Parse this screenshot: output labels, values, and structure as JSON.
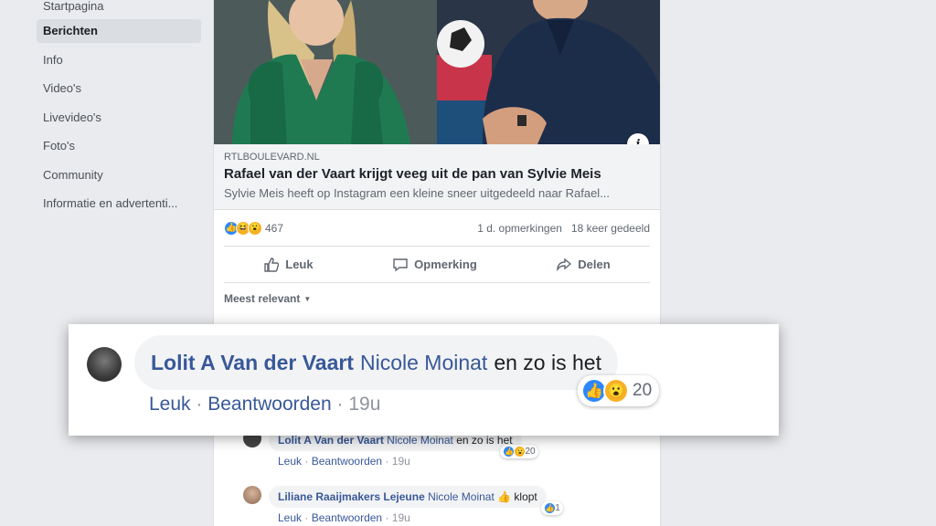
{
  "sidebar": {
    "items": [
      {
        "label": "Startpagina"
      },
      {
        "label": "Berichten"
      },
      {
        "label": "Info"
      },
      {
        "label": "Video's"
      },
      {
        "label": "Livevideo's"
      },
      {
        "label": "Foto's"
      },
      {
        "label": "Community"
      },
      {
        "label": "Informatie en advertenti..."
      }
    ],
    "active_index": 1
  },
  "post": {
    "link": {
      "source": "RTLBOULEVARD.NL",
      "title": "Rafael van der Vaart krijgt veeg uit de pan van Sylvie Meis",
      "description": "Sylvie Meis heeft op Instagram een kleine sneer uitgedeeld naar Rafael..."
    },
    "info_icon": "i",
    "stats": {
      "reaction_count": "467",
      "comments": "1 d. opmerkingen",
      "shares": "18 keer gedeeld"
    },
    "actions": {
      "like": "Leuk",
      "comment": "Opmerking",
      "share": "Delen"
    },
    "sort_label": "Meest relevant"
  },
  "zoomed_comment": {
    "author": "Lolit A Van der Vaart",
    "tag": "Nicole Moinat",
    "text": "en zo is het",
    "like": "Leuk",
    "reply": "Beantwoorden",
    "time": "19u",
    "reaction_count": "20",
    "separator": "·"
  },
  "comments": [
    {
      "author": "Lolit A Van der Vaart",
      "tag": "Nicole Moinat",
      "text": "en zo is het",
      "like": "Leuk",
      "reply": "Beantwoorden",
      "time": "19u",
      "reaction_count": "20",
      "separator": "·"
    },
    {
      "author": "Liliane Raaijmakers Lejeune",
      "tag": "Nicole Moinat",
      "text": "👍 klopt",
      "like": "Leuk",
      "reply": "Beantwoorden",
      "time": "19u",
      "reaction_count": "1",
      "separator": "·"
    }
  ],
  "colors": {
    "link_blue": "#385898",
    "like_blue": "#2d88ff",
    "emoji_yellow": "#f7b125",
    "page_bg": "#e9ebee"
  }
}
